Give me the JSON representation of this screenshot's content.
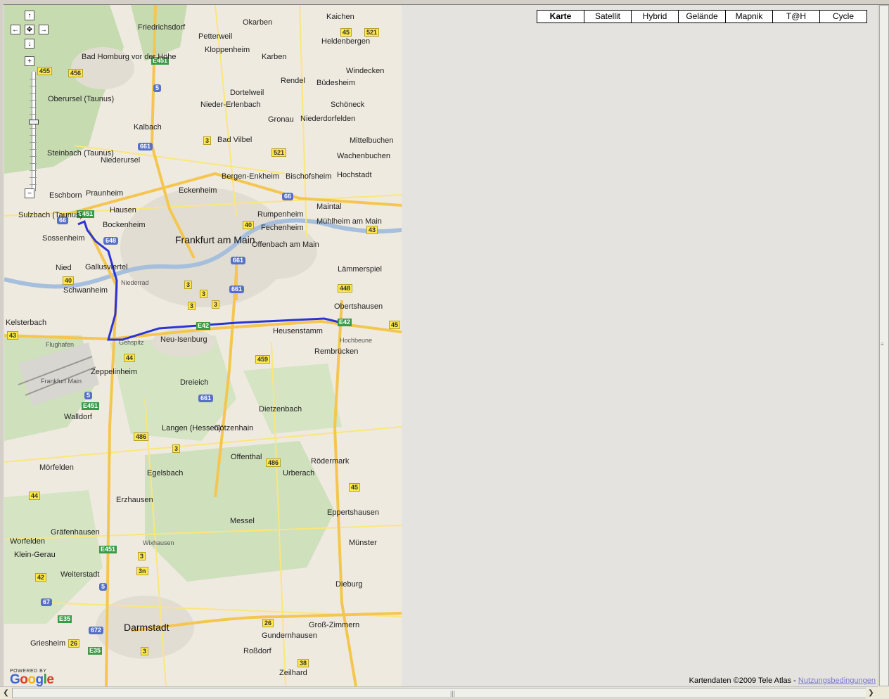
{
  "map_types": [
    {
      "label": "Karte",
      "active": true
    },
    {
      "label": "Satellit",
      "active": false
    },
    {
      "label": "Hybrid",
      "active": false
    },
    {
      "label": "Gelände",
      "active": false
    },
    {
      "label": "Mapnik",
      "active": false
    },
    {
      "label": "T@H",
      "active": false
    },
    {
      "label": "Cycle",
      "active": false
    }
  ],
  "pan_controls": {
    "up": "↑",
    "left": "←",
    "center": "✥",
    "right": "→",
    "down": "↓"
  },
  "zoom_controls": {
    "in": "+",
    "out": "−"
  },
  "copyright": {
    "text": "Kartendaten ©2009 Tele Atlas -",
    "link": "Nutzungsbedingungen"
  },
  "branding": {
    "powered": "POWERED BY",
    "google": "Google"
  },
  "colors": {
    "route": "#2a35d6",
    "autobahn": "#f5c64f",
    "road": "#fbe67a",
    "forest": "#c6dbb0",
    "urban": "#e2ddd2",
    "water": "#a5bfdd"
  },
  "labels": {
    "frankfurt": "Frankfurt am Main",
    "offenbach": "Offenbach am Main",
    "darmstadt": "Darmstadt",
    "neu_isenburg": "Neu-Isenburg",
    "heusenstamm": "Heusenstamm",
    "bad_homburg": "Bad Homburg vor der Höhe",
    "oberursel": "Oberursel (Taunus)",
    "friedrichsdorf": "Friedrichsdorf",
    "bad_vilbel": "Bad Vilbel",
    "dreieich": "Dreieich",
    "langen": "Langen (Hessen)",
    "dietzenbach": "Dietzenbach",
    "moerfelden": "Mörfelden",
    "egelsbach": "Egelsbach",
    "walldorf": "Walldorf",
    "zeppelinheim": "Zeppelinheim",
    "eschborn": "Eschborn",
    "sulzbach": "Sulzbach (Taunus)",
    "sossenheim": "Sossenheim",
    "schwanheim": "Schwanheim",
    "kelsterbach": "Kelsterbach",
    "niederrad": "Niederrad",
    "bockenheim": "Bockenheim",
    "hausen": "Hausen",
    "praunheim": "Praunheim",
    "eckenheim": "Eckenheim",
    "bergen_enkheim": "Bergen-Enkheim",
    "bischofsheim": "Bischofsheim",
    "fechenheim": "Fechenheim",
    "maintal": "Maintal",
    "muehlheim": "Mühlheim am Main",
    "obertshausen": "Obertshausen",
    "rembruecken": "Rembrücken",
    "roedermark": "Rödermark",
    "dieburg": "Dieburg",
    "muenster": "Münster",
    "eppertshausen": "Eppertshausen",
    "messel": "Messel",
    "erzhausen": "Erzhausen",
    "weiterstadt": "Weiterstadt",
    "griesheim": "Griesheim",
    "gross_zimmern": "Groß-Zimmern",
    "gundernhausen": "Gundernhausen",
    "rossdorf": "Roßdorf",
    "zeilhard": "Zeilhard",
    "offenthal": "Offenthal",
    "urberach": "Urberach",
    "goetzenhain": "Götzenhain",
    "graefenhausen": "Gräfenhausen",
    "woerfelden": "Worfelden",
    "klein_gerau": "Klein-Gerau",
    "wixhausen": "Wixhausen",
    "karben": "Karben",
    "rendel": "Rendel",
    "gronau": "Gronau",
    "niederdorfelden": "Niederdorfelden",
    "budesheim": "Büdesheim",
    "schoeneck": "Schöneck",
    "windecken": "Windecken",
    "mittelbuchen": "Mittelbuchen",
    "wachenbuchen": "Wachenbuchen",
    "hochstadt": "Hochstadt",
    "kaichen": "Kaichen",
    "heldenbergen": "Heldenbergen",
    "okarben": "Okarben",
    "petterweil": "Petterweil",
    "kloppenheim": "Kloppenheim",
    "dortelweil": "Dortelweil",
    "nieder_erlenbach": "Nieder-Erlenbach",
    "kalbach": "Kalbach",
    "niederursel": "Niederursel",
    "steinbach": "Steinbach (Taunus)",
    "nied": "Nied",
    "gallus": "Gallusviertel",
    "laemmerspiel": "Lämmerspiel",
    "rumpenheim": "Rumpenheim",
    "flughafen": "Flughafen",
    "frankfurt_main": "Frankfurt Main",
    "hochbeune": "Hochbeune",
    "gehspitz": "Gehspitz"
  }
}
